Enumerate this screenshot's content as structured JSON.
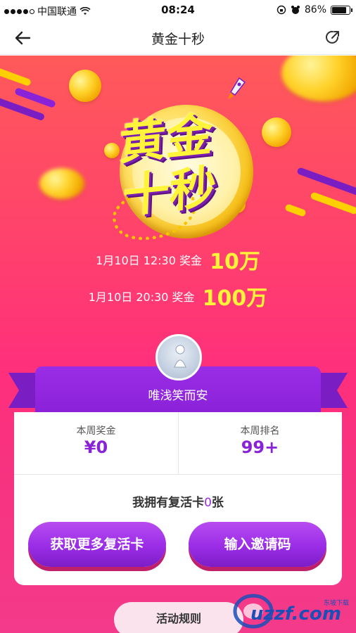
{
  "status_bar": {
    "carrier": "中国联通",
    "time": "08:24",
    "battery_text": "86%",
    "battery_level": 0.86
  },
  "nav": {
    "title": "黄金十秒"
  },
  "hero": {
    "logo_line1": "黄金",
    "logo_line2": "十秒",
    "prizes": [
      {
        "schedule": "1月10日 12:30 奖金",
        "amount": "10万"
      },
      {
        "schedule": "1月10日 20:30 奖金",
        "amount": "100万"
      }
    ]
  },
  "user": {
    "name": "唯浅笑而安"
  },
  "stats": {
    "weekly_prize_label": "本周奖金",
    "weekly_prize_value": "¥0",
    "weekly_rank_label": "本周排名",
    "weekly_rank_value": "99+"
  },
  "revive": {
    "prefix": "我拥有复活卡",
    "count": "0",
    "suffix": "张"
  },
  "buttons": {
    "get_more_label": "获取更多复活卡",
    "invite_code_label": "输入邀请码",
    "rules_label": "活动规则"
  },
  "watermark": {
    "text": "uzzf.com",
    "small": "东坡下载"
  },
  "colors": {
    "accent_purple": "#9a2de6",
    "hero_pink": "#ff3f6e",
    "prize_yellow": "#fff33a"
  }
}
